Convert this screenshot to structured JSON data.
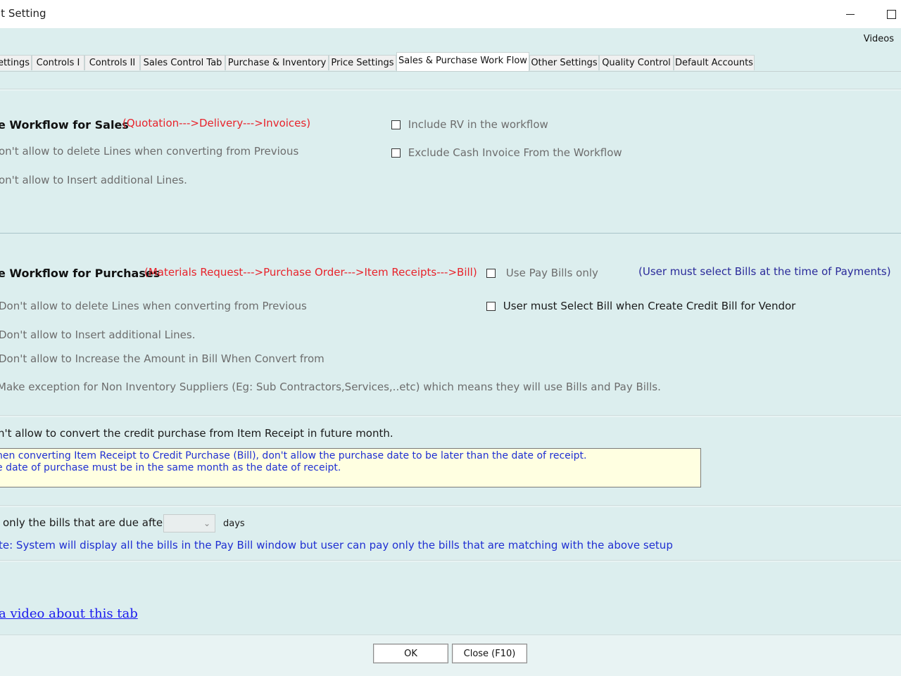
{
  "window": {
    "title": "lt Setting",
    "minimize_icon": "minimize-icon",
    "maximize_icon": "maximize-icon"
  },
  "header": {
    "videos_label": "Videos"
  },
  "tabs": [
    {
      "label": "ettings"
    },
    {
      "label": "Controls I"
    },
    {
      "label": "Controls II"
    },
    {
      "label": "Sales Control Tab"
    },
    {
      "label": "Purchase & Inventory"
    },
    {
      "label": "Price Settings"
    },
    {
      "label": "Sales & Purchase Work Flow",
      "active": true
    },
    {
      "label": "Other Settings"
    },
    {
      "label": "Quality Control"
    },
    {
      "label": "Default Accounts"
    }
  ],
  "sales": {
    "title": "e Workflow for Sales",
    "flow": "(Quotation--->Delivery--->Invoices)",
    "no_delete": "on't allow to delete Lines when converting from Previous",
    "no_insert": "on't allow to Insert additional Lines.",
    "include_rv": "Include RV in the workflow",
    "exclude_cash": "Exclude Cash Invoice From the Workflow"
  },
  "purchases": {
    "title": "e Workflow for Purchases",
    "flow": "(Materials Request--->Purchase Order--->Item Receipts--->Bill)",
    "use_pay_bills": "Use Pay Bills only",
    "pay_bills_note": "(User must select Bills at the time of Payments)",
    "credit_bill": "User must Select Bill when Create Credit Bill for Vendor",
    "no_delete": "Don't allow to delete Lines when converting from Previous",
    "no_insert": "Don't allow to Insert additional Lines.",
    "no_increase": "Don't allow to Increase the Amount in Bill When Convert from",
    "exception": "Make exception for Non Inventory Suppliers (Eg: Sub Contractors,Services,..etc) which means they will use Bills and Pay Bills."
  },
  "credit_purchase": {
    "label": "n't allow to convert the credit purchase from Item Receipt in future month.",
    "note_line1": "hen converting Item Receipt to Credit Purchase (Bill), don't allow the purchase date to be later than the date of receipt.",
    "note_line2": "e date of purchase must be in the same month as the date of receipt."
  },
  "bills_due": {
    "label": "only the bills that are due after",
    "days_value": "",
    "days_label": "days",
    "note": "te: System will display all the bills in the Pay Bill window but user can pay only the bills that are matching with the above setup"
  },
  "video_link": "a video about this tab",
  "buttons": {
    "ok": "OK",
    "close": "Close (F10)"
  },
  "colors": {
    "background": "#dceeee",
    "red_text": "#e8232b",
    "blue_text": "#1f2fd2",
    "note_bg": "#ffffe1",
    "link": "#1a1aee"
  }
}
